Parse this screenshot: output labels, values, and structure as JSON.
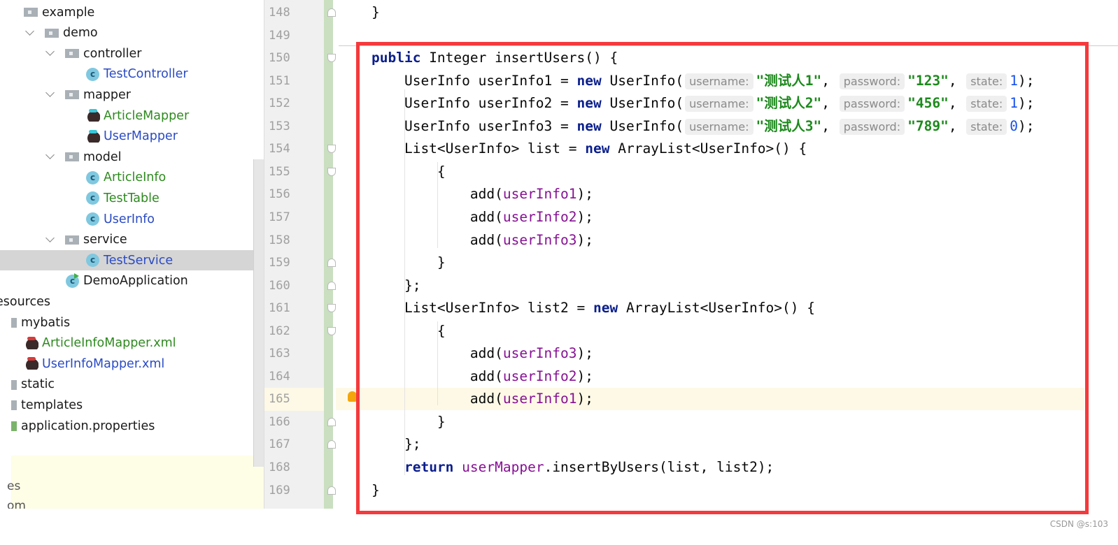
{
  "project_tree": {
    "items": [
      {
        "label": "example",
        "type": "folder",
        "color": "default"
      },
      {
        "label": "demo",
        "type": "folder",
        "color": "default"
      },
      {
        "label": "controller",
        "type": "folder",
        "color": "default"
      },
      {
        "label": "TestController",
        "type": "class",
        "color": "blue"
      },
      {
        "label": "mapper",
        "type": "folder",
        "color": "default"
      },
      {
        "label": "ArticleMapper",
        "type": "mybatis",
        "color": "green"
      },
      {
        "label": "UserMapper",
        "type": "mybatis",
        "color": "blue"
      },
      {
        "label": "model",
        "type": "folder",
        "color": "default"
      },
      {
        "label": "ArticleInfo",
        "type": "class",
        "color": "green"
      },
      {
        "label": "TestTable",
        "type": "class",
        "color": "green"
      },
      {
        "label": "UserInfo",
        "type": "class",
        "color": "blue"
      },
      {
        "label": "service",
        "type": "folder",
        "color": "default"
      },
      {
        "label": "TestService",
        "type": "class",
        "color": "blue",
        "selected": true
      },
      {
        "label": "DemoApplication",
        "type": "app-class",
        "color": "default"
      },
      {
        "label": "esources",
        "type": "text",
        "color": "default"
      },
      {
        "label": "mybatis",
        "type": "folder",
        "color": "default"
      },
      {
        "label": "ArticleInfoMapper.xml",
        "type": "mybatis-xml",
        "color": "green"
      },
      {
        "label": "UserInfoMapper.xml",
        "type": "mybatis-xml",
        "color": "blue"
      },
      {
        "label": "static",
        "type": "folder",
        "color": "default"
      },
      {
        "label": "templates",
        "type": "folder",
        "color": "default"
      },
      {
        "label": "application.properties",
        "type": "properties",
        "color": "default"
      }
    ],
    "bottom_panel": [
      "es",
      "om"
    ]
  },
  "editor": {
    "line_numbers": [
      "148",
      "149",
      "150",
      "151",
      "152",
      "153",
      "154",
      "155",
      "156",
      "157",
      "158",
      "159",
      "160",
      "161",
      "162",
      "163",
      "164",
      "165",
      "166",
      "167",
      "168",
      "169"
    ],
    "current_line": "165",
    "lines": [
      [
        [
          "}",
          ""
        ]
      ],
      [],
      [
        [
          "public",
          "kw"
        ],
        [
          " Integer insertUsers() {",
          ""
        ]
      ],
      [
        [
          "    UserInfo userInfo1 = ",
          ""
        ],
        [
          "new",
          "kw"
        ],
        [
          " UserInfo(",
          ""
        ],
        [
          "username:",
          "hint"
        ],
        [
          "\"测试人1\"",
          "str"
        ],
        [
          ", ",
          ""
        ],
        [
          "password:",
          "hint"
        ],
        [
          "\"123\"",
          "str"
        ],
        [
          ", ",
          ""
        ],
        [
          "state:",
          "hint"
        ],
        [
          "1",
          "num"
        ],
        [
          ");",
          ""
        ]
      ],
      [
        [
          "    UserInfo userInfo2 = ",
          ""
        ],
        [
          "new",
          "kw"
        ],
        [
          " UserInfo(",
          ""
        ],
        [
          "username:",
          "hint"
        ],
        [
          "\"测试人2\"",
          "str"
        ],
        [
          ", ",
          ""
        ],
        [
          "password:",
          "hint"
        ],
        [
          "\"456\"",
          "str"
        ],
        [
          ", ",
          ""
        ],
        [
          "state:",
          "hint"
        ],
        [
          "1",
          "num"
        ],
        [
          ");",
          ""
        ]
      ],
      [
        [
          "    UserInfo userInfo3 = ",
          ""
        ],
        [
          "new",
          "kw"
        ],
        [
          " UserInfo(",
          ""
        ],
        [
          "username:",
          "hint"
        ],
        [
          "\"测试人3\"",
          "str"
        ],
        [
          ", ",
          ""
        ],
        [
          "password:",
          "hint"
        ],
        [
          "\"789\"",
          "str"
        ],
        [
          ", ",
          ""
        ],
        [
          "state:",
          "hint"
        ],
        [
          "0",
          "num"
        ],
        [
          ");",
          ""
        ]
      ],
      [
        [
          "    List<UserInfo> list = ",
          ""
        ],
        [
          "new",
          "kw"
        ],
        [
          " ArrayList<UserInfo>() {",
          ""
        ]
      ],
      [
        [
          "        {",
          ""
        ]
      ],
      [
        [
          "            add(",
          ""
        ],
        [
          "userInfo1",
          "field"
        ],
        [
          ");",
          ""
        ]
      ],
      [
        [
          "            add(",
          ""
        ],
        [
          "userInfo2",
          "field"
        ],
        [
          ");",
          ""
        ]
      ],
      [
        [
          "            add(",
          ""
        ],
        [
          "userInfo3",
          "field"
        ],
        [
          ");",
          ""
        ]
      ],
      [
        [
          "        }",
          ""
        ]
      ],
      [
        [
          "    };",
          ""
        ]
      ],
      [
        [
          "    List<UserInfo> list2 = ",
          ""
        ],
        [
          "new",
          "kw"
        ],
        [
          " ArrayList<UserInfo>() {",
          ""
        ]
      ],
      [
        [
          "        {",
          ""
        ]
      ],
      [
        [
          "            add(",
          ""
        ],
        [
          "userInfo3",
          "field"
        ],
        [
          ");",
          ""
        ]
      ],
      [
        [
          "            add(",
          ""
        ],
        [
          "userInfo2",
          "field"
        ],
        [
          ");",
          ""
        ]
      ],
      [
        [
          "            add(",
          ""
        ],
        [
          "userInfo1",
          "field"
        ],
        [
          ");",
          ""
        ]
      ],
      [
        [
          "        }",
          ""
        ]
      ],
      [
        [
          "    };",
          ""
        ]
      ],
      [
        [
          "    ",
          ""
        ],
        [
          "return",
          "kw"
        ],
        [
          " ",
          ""
        ],
        [
          "userMapper",
          "field"
        ],
        [
          ".insertByUsers(list, list2);",
          ""
        ]
      ],
      [
        [
          "}",
          ""
        ]
      ]
    ]
  },
  "highlight_color": "#f5393c",
  "watermark": "CSDN @s:103"
}
